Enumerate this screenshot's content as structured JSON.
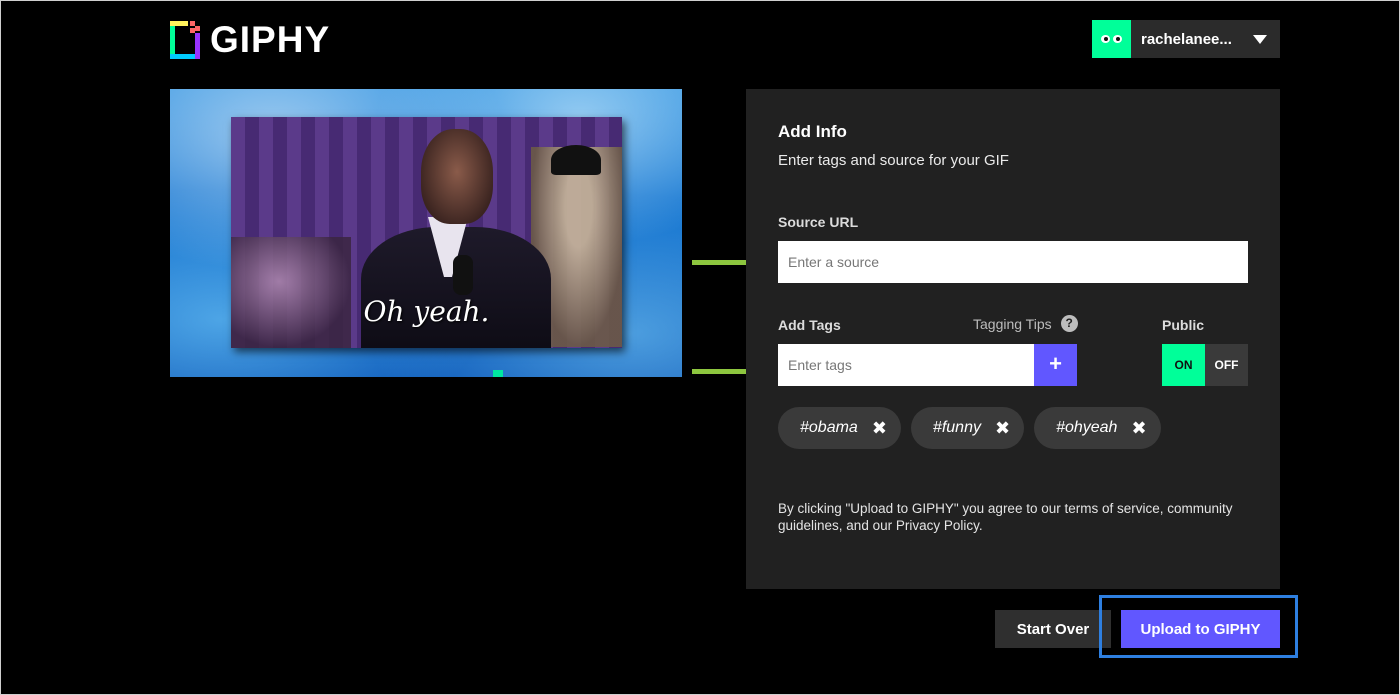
{
  "header": {
    "logo_text": "GIPHY",
    "username": "rachelanee..."
  },
  "preview": {
    "caption": "Oh yeah."
  },
  "panel": {
    "title": "Add Info",
    "subtitle": "Enter tags and source for your GIF",
    "source_label": "Source URL",
    "source_placeholder": "Enter a source",
    "tags_label": "Add Tags",
    "tagging_tips": "Tagging Tips",
    "help_icon_glyph": "?",
    "tags_placeholder": "Enter tags",
    "add_tag_glyph": "+",
    "public_label": "Public",
    "toggle_on": "ON",
    "toggle_off": "OFF",
    "tags": [
      "#obama",
      "#funny",
      "#ohyeah"
    ],
    "remove_glyph": "✖",
    "legal": "By clicking \"Upload to GIPHY\" you agree to our terms of service, community guidelines, and our Privacy Policy."
  },
  "actions": {
    "start_over": "Start Over",
    "upload": "Upload to GIPHY"
  },
  "colors": {
    "accent_purple": "#6157ff",
    "accent_green": "#00ff99",
    "annotation_arrow": "#8dc63f",
    "annotation_box": "#2e7fe0"
  }
}
